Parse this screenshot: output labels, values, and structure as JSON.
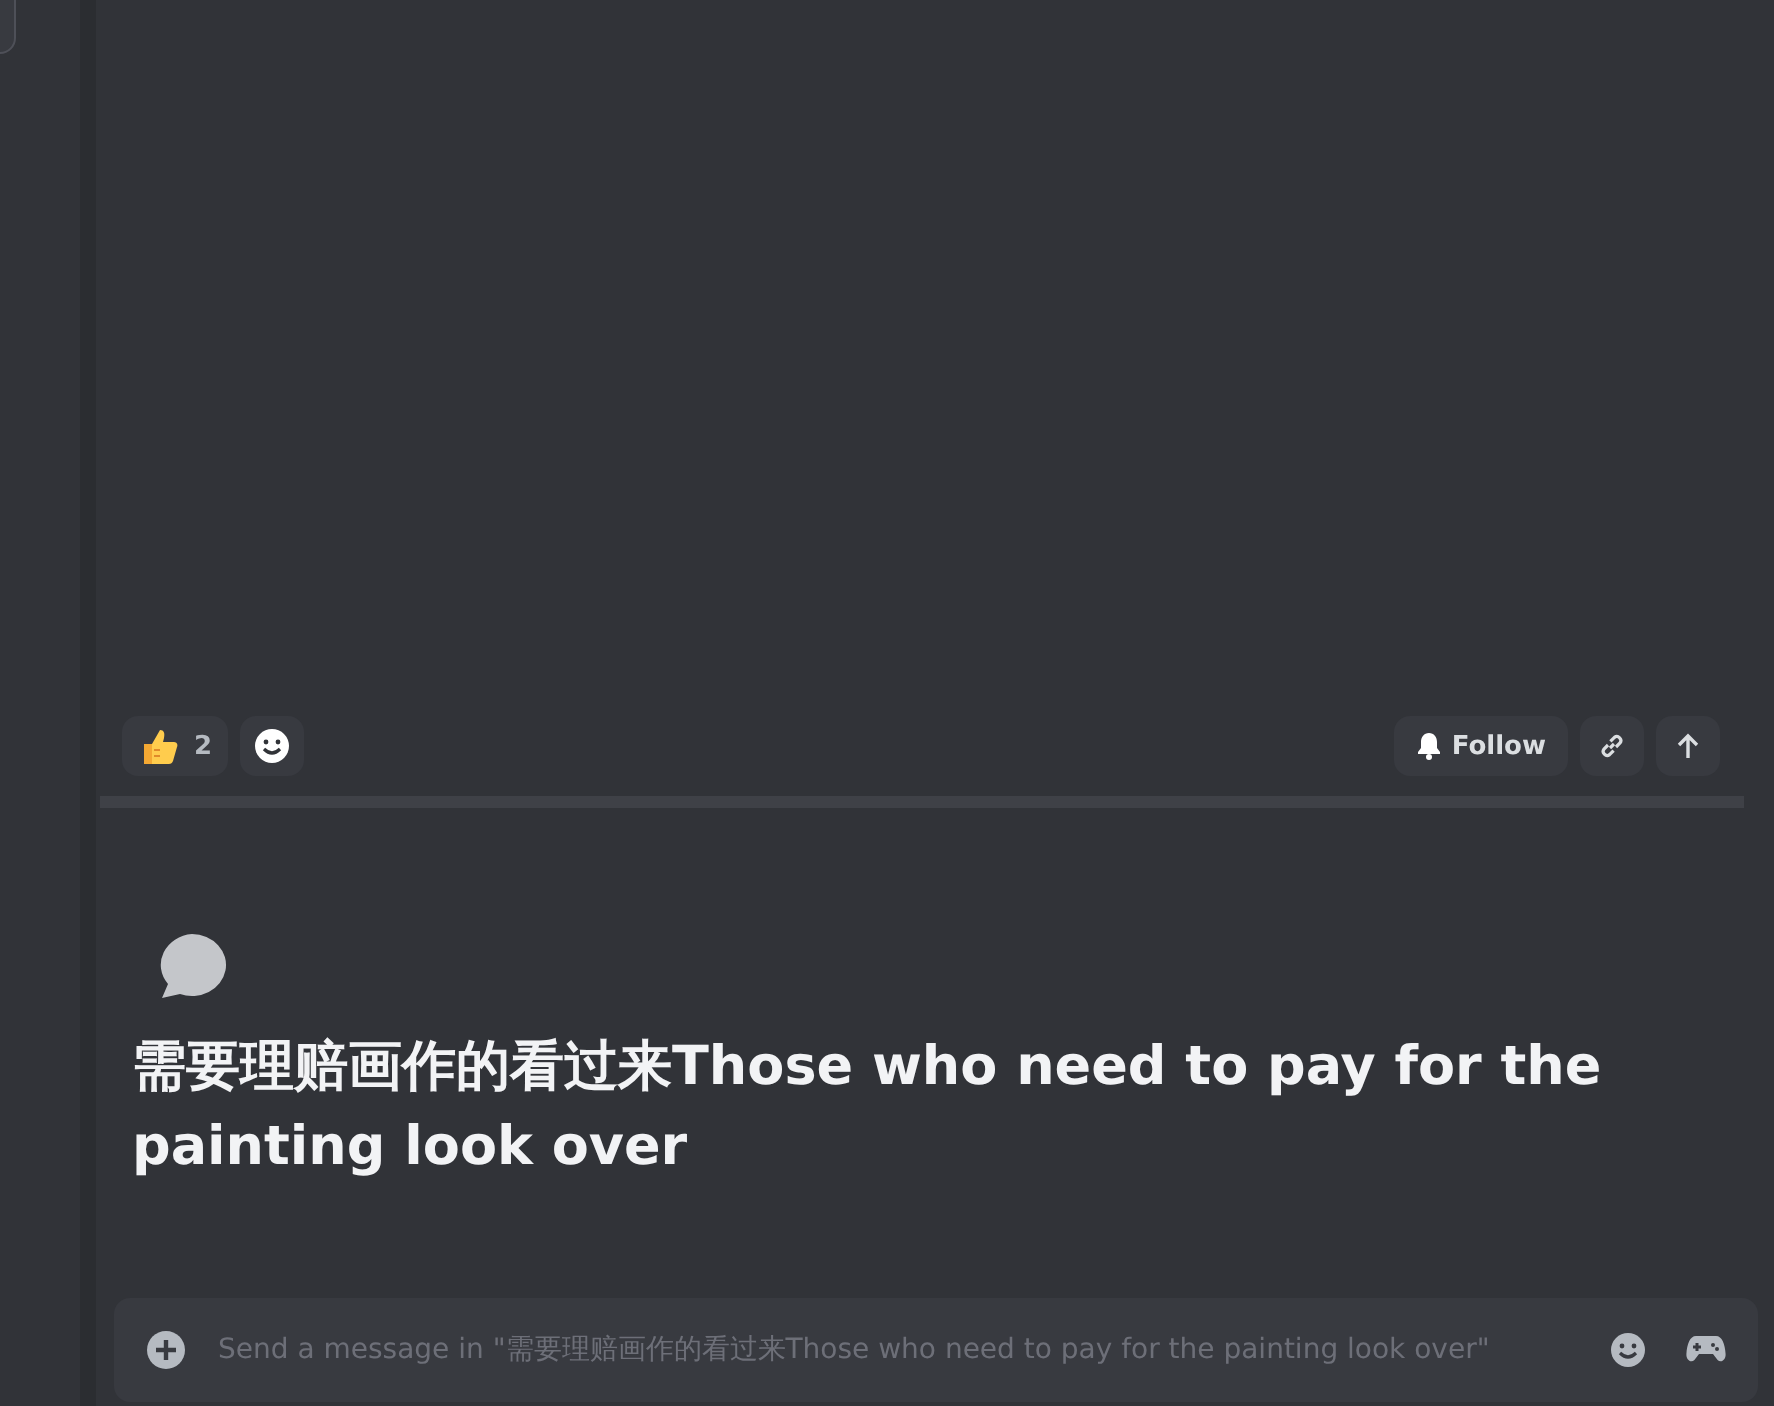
{
  "reactions": [
    {
      "kind": "emoji",
      "count": "2"
    },
    {
      "kind": "add"
    }
  ],
  "post_actions": [
    {
      "kind": "follow",
      "label": "Follow"
    },
    {
      "kind": "link"
    },
    {
      "kind": "up"
    }
  ],
  "thread": {
    "title": "需要理赔画作的看过来Those who need to pay for the painting look over"
  },
  "composer": {
    "placeholder": "Send a message in \"需要理赔画作的看过来Those who need to pay for the painting look over\""
  }
}
